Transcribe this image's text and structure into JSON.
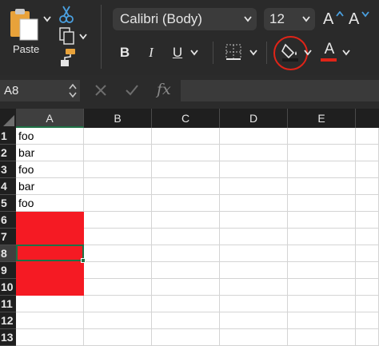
{
  "toolbar": {
    "paste_label": "Paste",
    "font_name": "Calibri (Body)",
    "font_size": "12",
    "bold_label": "B",
    "italic_label": "I",
    "underline_label": "U",
    "grow_font_label": "A",
    "shrink_font_label": "A",
    "font_color_label": "A",
    "fill_color": "#1a1a1a",
    "font_color": "#e02418",
    "highlight_ring_color": "#e02418"
  },
  "formula_bar": {
    "name_box": "A8",
    "fx_label": "fx",
    "value": ""
  },
  "sheet": {
    "columns": [
      "A",
      "B",
      "C",
      "D",
      "E"
    ],
    "selected_column": "A",
    "selected_cell": "A8",
    "fill_color": "#f51a23",
    "rows": [
      {
        "num": "1",
        "a": "foo"
      },
      {
        "num": "2",
        "a": "bar"
      },
      {
        "num": "3",
        "a": "foo"
      },
      {
        "num": "4",
        "a": "bar"
      },
      {
        "num": "5",
        "a": "foo"
      },
      {
        "num": "6",
        "a": ""
      },
      {
        "num": "7",
        "a": ""
      },
      {
        "num": "8",
        "a": ""
      },
      {
        "num": "9",
        "a": ""
      },
      {
        "num": "10",
        "a": ""
      },
      {
        "num": "11",
        "a": ""
      },
      {
        "num": "12",
        "a": ""
      },
      {
        "num": "13",
        "a": ""
      }
    ]
  }
}
